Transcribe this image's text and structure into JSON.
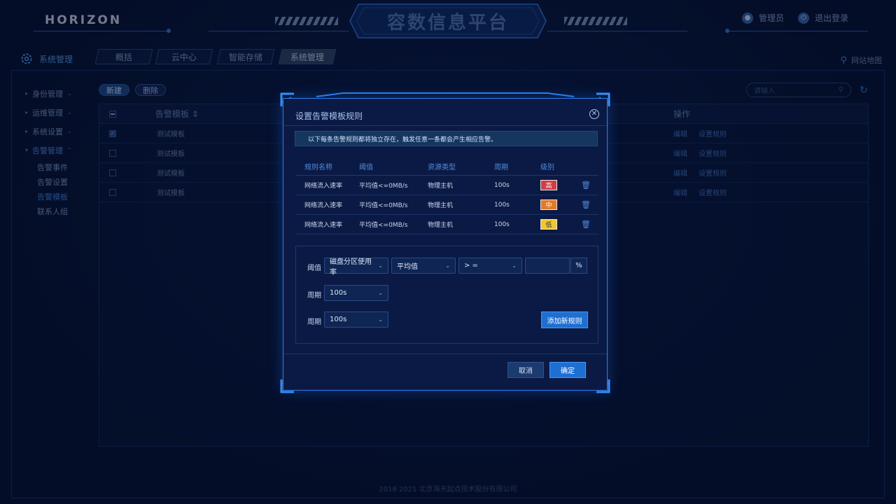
{
  "header": {
    "logo": "HORIZON",
    "title": "容数信息平台",
    "user_label": "管理员",
    "logout_label": "退出登录"
  },
  "nav": {
    "section_title": "系统管理",
    "tabs": [
      {
        "label": "概括",
        "active": false
      },
      {
        "label": "云中心",
        "active": false
      },
      {
        "label": "智能存储",
        "active": false
      },
      {
        "label": "系统管理",
        "active": true
      }
    ],
    "sitemap_label": "网站地图"
  },
  "sidebar": {
    "items": [
      {
        "label": "身份管理"
      },
      {
        "label": "运维管理"
      },
      {
        "label": "系统设置"
      },
      {
        "label": "告警管理",
        "open": true
      }
    ],
    "subitems": [
      {
        "label": "告警事件",
        "active": false
      },
      {
        "label": "告警设置",
        "active": false
      },
      {
        "label": "告警模板",
        "active": true
      },
      {
        "label": "联系人组",
        "active": false
      }
    ]
  },
  "toolbar": {
    "new_label": "新建",
    "delete_label": "删除",
    "search_placeholder": "请输入"
  },
  "table": {
    "header_name": "告警模板",
    "header_op": "操作",
    "rows": [
      {
        "name": "测试模板",
        "checked": true
      },
      {
        "name": "测试模板",
        "checked": false
      },
      {
        "name": "测试模板",
        "checked": false
      },
      {
        "name": "测试模板",
        "checked": false
      }
    ],
    "op_edit": "编辑",
    "op_rules": "设置规则"
  },
  "footer": {
    "copyright": "2018 2021 北京海天起点技术股份有限公司"
  },
  "modal": {
    "title": "设置告警模板规则",
    "notice": "以下每条告警规则都将独立存在，触发任意一条都会产生相应告警。",
    "columns": [
      "规则名称",
      "阈值",
      "资源类型",
      "周期",
      "级别"
    ],
    "rules": [
      {
        "name": "网络流入速率",
        "threshold": "平均值<=0MB/s",
        "resource": "物理主机",
        "period": "100s",
        "level": "高",
        "level_color": "#d33c46"
      },
      {
        "name": "网络流入速率",
        "threshold": "平均值<=0MB/s",
        "resource": "物理主机",
        "period": "100s",
        "level": "中",
        "level_color": "#e07a2a"
      },
      {
        "name": "网络流入速率",
        "threshold": "平均值<=0MB/s",
        "resource": "物理主机",
        "period": "100s",
        "level": "低",
        "level_color": "#f1c530"
      }
    ],
    "form": {
      "threshold_label": "阈值",
      "metric": "磁盘分区使用率",
      "aggregate": "平均值",
      "operator": "> =",
      "value": "",
      "unit": "%",
      "period_label_1": "周期",
      "period_value_1": "100s",
      "period_label_2": "周期",
      "period_value_2": "100s",
      "add_label": "添加新规则"
    },
    "cancel_label": "取消",
    "ok_label": "确定"
  }
}
